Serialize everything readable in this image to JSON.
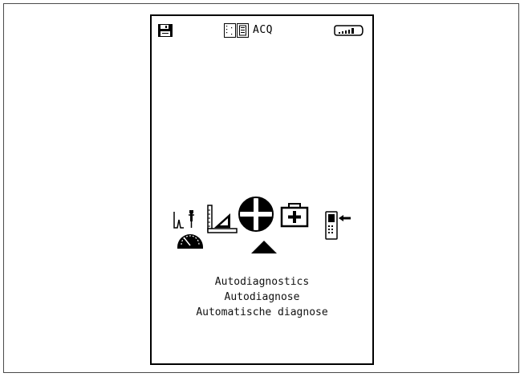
{
  "status_bar": {
    "mode_label": "ACQ",
    "icons": {
      "save": "floppy-disk-icon",
      "mode": "acquisition-panel-icon",
      "battery": "battery-icon"
    },
    "battery_level": 0.8
  },
  "menu": {
    "items": [
      {
        "id": "measurement",
        "icon": "meter-probe-icon"
      },
      {
        "id": "calibration",
        "icon": "ruler-triangle-icon"
      },
      {
        "id": "autodiagnostics",
        "icon": "crosshair-circle-icon",
        "selected": true
      },
      {
        "id": "first-aid",
        "icon": "first-aid-kit-icon"
      },
      {
        "id": "transfer",
        "icon": "device-transfer-icon"
      }
    ],
    "selection_marker": "up-triangle-icon"
  },
  "selected_labels": {
    "line1": "Autodiagnostics",
    "line2": "Autodiagnose",
    "line3": "Automatische diagnose"
  }
}
